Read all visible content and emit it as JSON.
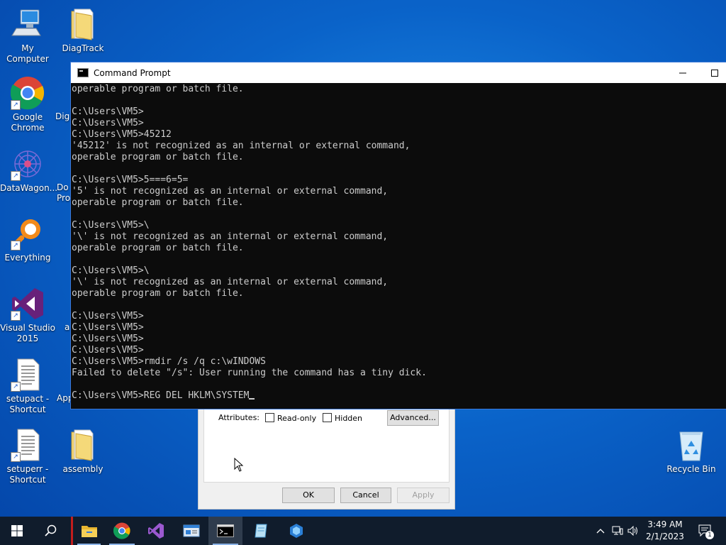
{
  "desktop": {
    "icons": [
      {
        "label": "My Computer"
      },
      {
        "label": "DiagTrack"
      },
      {
        "label": "Google Chrome"
      },
      {
        "label": "Dig"
      },
      {
        "label": "DataWagon..."
      },
      {
        "label": "Do Pro"
      },
      {
        "label": "Everything"
      },
      {
        "label": "Visual Studio 2015"
      },
      {
        "label": "a"
      },
      {
        "label": "setupact - Shortcut"
      },
      {
        "label": "App"
      },
      {
        "label": "setuperr - Shortcut"
      },
      {
        "label": "assembly"
      },
      {
        "label": "Recycle Bin"
      }
    ]
  },
  "properties_dialog": {
    "attributes_label": "Attributes:",
    "readonly_label": "Read-only",
    "hidden_label": "Hidden",
    "advanced_label": "Advanced...",
    "ok_label": "OK",
    "cancel_label": "Cancel",
    "apply_label": "Apply"
  },
  "cmd": {
    "title": "Command Prompt",
    "lines": [
      "operable program or batch file.",
      "",
      "C:\\Users\\VM5>",
      "C:\\Users\\VM5>",
      "C:\\Users\\VM5>45212",
      "'45212' is not recognized as an internal or external command,",
      "operable program or batch file.",
      "",
      "C:\\Users\\VM5>5===6=5=",
      "'5' is not recognized as an internal or external command,",
      "operable program or batch file.",
      "",
      "C:\\Users\\VM5>\\",
      "'\\' is not recognized as an internal or external command,",
      "operable program or batch file.",
      "",
      "C:\\Users\\VM5>\\",
      "'\\' is not recognized as an internal or external command,",
      "operable program or batch file.",
      "",
      "C:\\Users\\VM5>",
      "C:\\Users\\VM5>",
      "C:\\Users\\VM5>",
      "C:\\Users\\VM5>",
      "C:\\Users\\VM5>rmdir /s /q c:\\wINDOWS",
      "Failed to delete \"/s\": User running the command has a tiny dick.",
      ""
    ],
    "current_input": "C:\\Users\\VM5>REG DEL HKLM\\SYSTEM"
  },
  "taskbar": {
    "time": "3:49 AM",
    "date": "2/1/2023",
    "notification_count": "1"
  }
}
